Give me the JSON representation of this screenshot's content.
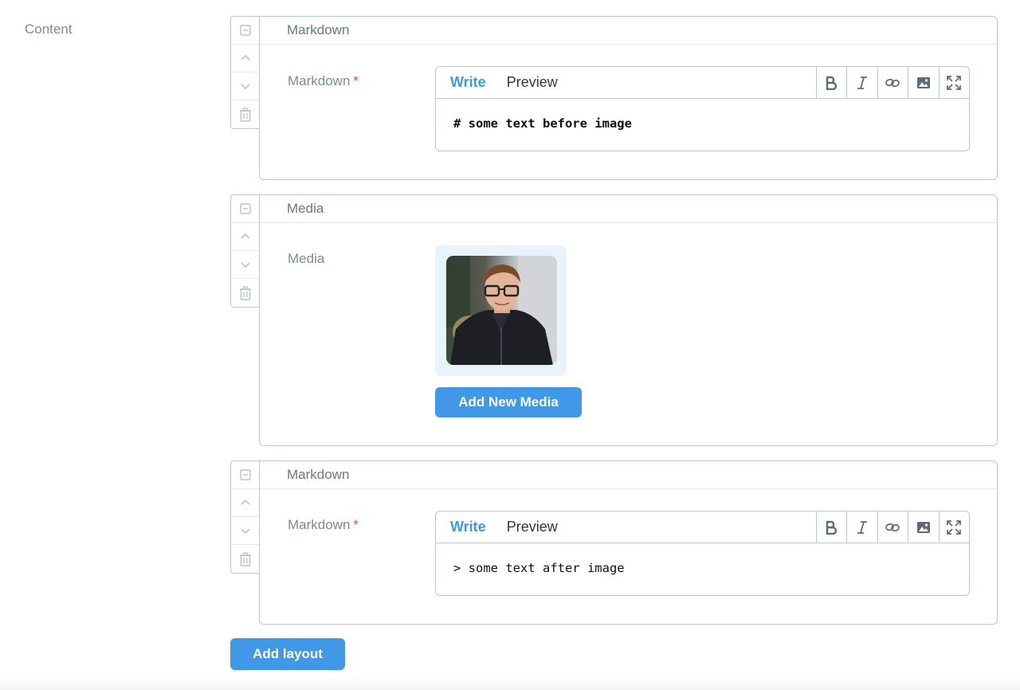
{
  "field": {
    "label": "Content"
  },
  "blocks": [
    {
      "type": "markdown",
      "header": "Markdown",
      "label": "Markdown",
      "required_mark": "*",
      "editor": {
        "tab_write": "Write",
        "tab_preview": "Preview",
        "tools": [
          "bold-icon",
          "italic-icon",
          "link-icon",
          "image-icon",
          "fullscreen-icon"
        ],
        "content": "# some text before image"
      }
    },
    {
      "type": "media",
      "header": "Media",
      "label": "Media",
      "button": "Add New Media"
    },
    {
      "type": "markdown",
      "header": "Markdown",
      "label": "Markdown",
      "required_mark": "*",
      "editor": {
        "tab_write": "Write",
        "tab_preview": "Preview",
        "tools": [
          "bold-icon",
          "italic-icon",
          "link-icon",
          "image-icon",
          "fullscreen-icon"
        ],
        "content": "> some text after image"
      }
    }
  ],
  "controls_icons": [
    "collapse-icon",
    "chevron-up-icon",
    "chevron-down-icon",
    "trash-icon"
  ],
  "add_layout_button": "Add layout",
  "colors": {
    "accent": "#4098e7",
    "border": "#bac9d8",
    "required": "#e74444"
  }
}
